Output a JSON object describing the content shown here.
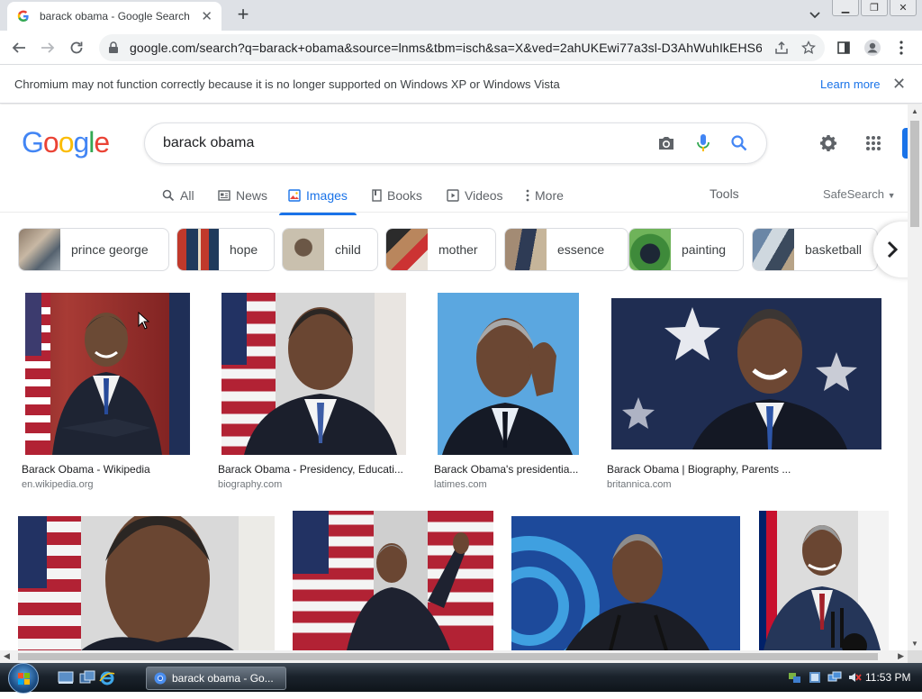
{
  "browser": {
    "tab_title": "barack obama - Google Search",
    "url": "google.com/search?q=barack+obama&source=lnms&tbm=isch&sa=X&ved=2ahUKEwi77a3sl-D3AhWuhIkEHS6...",
    "info_message": "Chromium may not function correctly because it is no longer supported on Windows XP or Windows Vista",
    "info_link": "Learn more"
  },
  "search": {
    "logo": [
      "G",
      "o",
      "o",
      "g",
      "l",
      "e"
    ],
    "logo_colors": [
      "#4285f4",
      "#ea4335",
      "#fbbc05",
      "#4285f4",
      "#34a853",
      "#ea4335"
    ],
    "query": "barack obama"
  },
  "nav": {
    "tabs": [
      "All",
      "News",
      "Images",
      "Books",
      "Videos",
      "More"
    ],
    "active_tab": "Images",
    "tools": "Tools",
    "safesearch": "SafeSearch"
  },
  "chips": [
    "prince george",
    "hope",
    "child",
    "mother",
    "essence",
    "painting",
    "basketball"
  ],
  "results": [
    {
      "caption": "Barack Obama - Wikipedia",
      "source": "en.wikipedia.org"
    },
    {
      "caption": "Barack Obama - Presidency, Educati...",
      "source": "biography.com"
    },
    {
      "caption": "Barack Obama's presidentia...",
      "source": "latimes.com"
    },
    {
      "caption": "Barack Obama | Biography, Parents ...",
      "source": "britannica.com"
    }
  ],
  "taskbar": {
    "task_label": "barack obama - Go...",
    "clock": "11:53 PM"
  },
  "colors": {
    "accent": "#1a73e8",
    "tab_strip": "#dee1e6"
  }
}
